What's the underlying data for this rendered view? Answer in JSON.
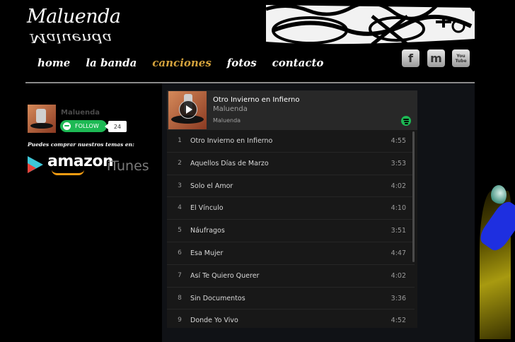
{
  "site": {
    "logo_text": "Maluenda",
    "nav": [
      {
        "label": "home",
        "active": false
      },
      {
        "label": "la banda",
        "active": false
      },
      {
        "label": "canciones",
        "active": true
      },
      {
        "label": "fotos",
        "active": false
      },
      {
        "label": "contacto",
        "active": false
      }
    ],
    "social": [
      {
        "name": "facebook-icon",
        "glyph": "f"
      },
      {
        "name": "myspace-icon",
        "glyph": "m"
      },
      {
        "name": "youtube-icon",
        "glyph": "You Tube"
      }
    ],
    "accent_color": "#d4a23c"
  },
  "sidebar": {
    "artist_name": "Maluenda",
    "follow_label": "FOLLOW",
    "follower_count": "24",
    "buy_text": "Puedes comprar nuestros temas en:",
    "stores": {
      "amazon": "amazon",
      "itunes": "iTunes"
    }
  },
  "player": {
    "title": "Otro Invierno en Infierno",
    "artist": "Maluenda",
    "owner": "Maluenda",
    "tracks": [
      {
        "num": "1",
        "name": "Otro Invierno en Infierno",
        "dur": "4:55"
      },
      {
        "num": "2",
        "name": "Aquellos Días de Marzo",
        "dur": "3:53"
      },
      {
        "num": "3",
        "name": "Solo el Amor",
        "dur": "4:02"
      },
      {
        "num": "4",
        "name": "El Vínculo",
        "dur": "4:10"
      },
      {
        "num": "5",
        "name": "Náufragos",
        "dur": "3:51"
      },
      {
        "num": "6",
        "name": "Esa Mujer",
        "dur": "4:47"
      },
      {
        "num": "7",
        "name": "Así Te Quiero Querer",
        "dur": "4:02"
      },
      {
        "num": "8",
        "name": "Sin Documentos",
        "dur": "3:36"
      },
      {
        "num": "9",
        "name": "Donde Yo Vivo",
        "dur": "4:52"
      }
    ],
    "brand_color": "#1db954"
  }
}
